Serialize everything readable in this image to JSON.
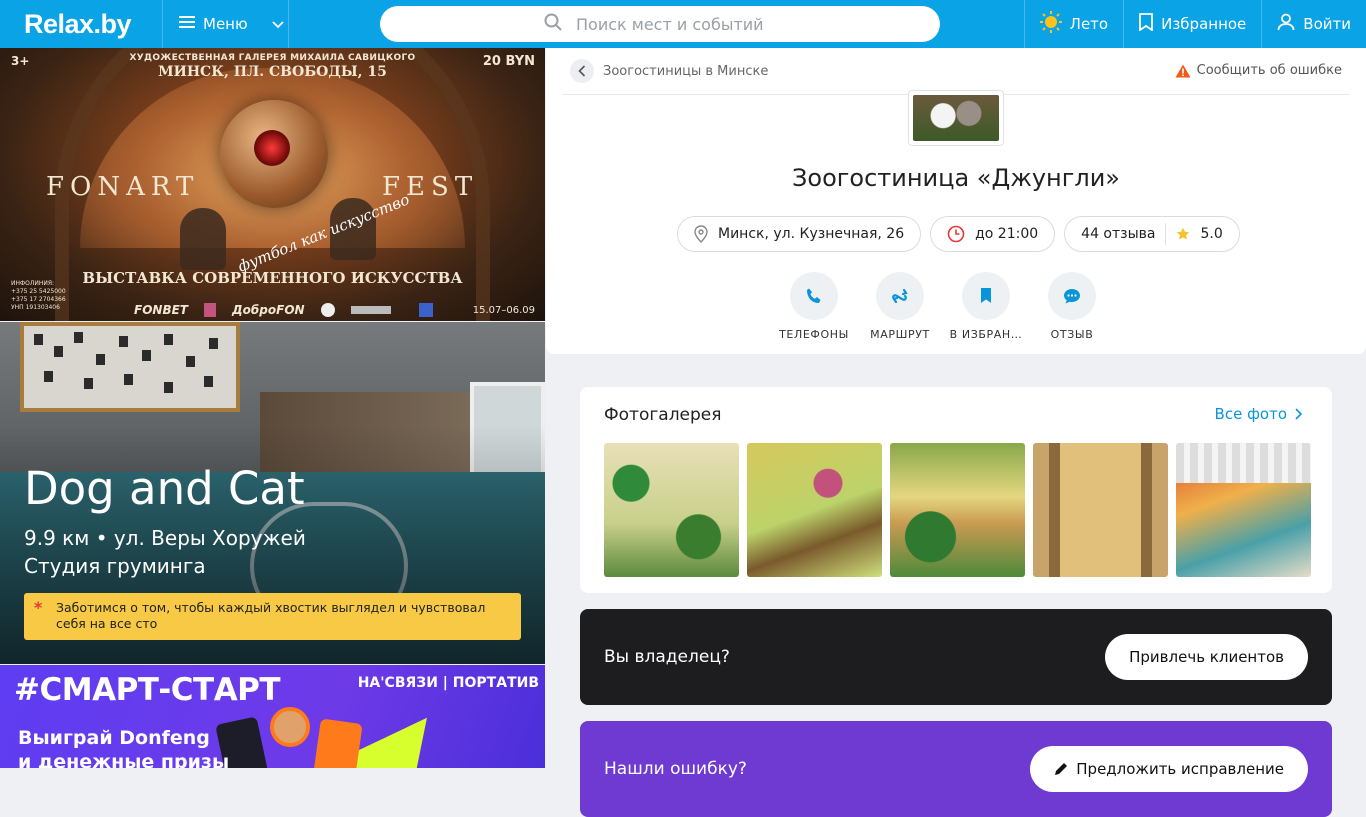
{
  "header": {
    "logo": "Relax.by",
    "menu_label": "Меню",
    "search_placeholder": "Поиск мест и событий",
    "season_label": "Лето",
    "favorites_label": "Избранное",
    "login_label": "Войти",
    "accent_color": "#0aa3e6"
  },
  "ads": {
    "banner1": {
      "age": "3+",
      "gallery": "ХУДОЖЕСТВЕННАЯ ГАЛЕРЕЯ МИХАИЛА САВИЦКОГО",
      "address": "МИНСК, ПЛ. СВОБОДЫ, 15",
      "price": "20 BYN",
      "title_left": "FONART",
      "title_right": "FEST",
      "slogan": "футбол как искусство",
      "subtitle": "ВЫСТАВКА СОВРЕМЕННОГО ИСКУССТВА",
      "info_line1": "ИНФОЛИНИЯ:",
      "info_line2": "+375 25 5425000",
      "info_line3": "+375 17 2704366",
      "info_line4": "УНП 191303406",
      "sponsor1": "FONBET",
      "sponsor2": "ДоброFON",
      "dates": "15.07–06.09"
    },
    "banner2": {
      "title": "Dog and Cat",
      "distance": "9.9 км • ул. Веры Хоружей",
      "type": "Студия груминга",
      "note": "Заботимся о том, чтобы каждый хвостик выглядел и чувствовал себя на все сто"
    },
    "banner3": {
      "title": "#СМАРТ-СТАРТ",
      "brands": "НА'СВЯЗИ | ПОРТАТИВ",
      "line1": "Выиграй Donfeng",
      "line2": "и денежные призы"
    }
  },
  "breadcrumb": {
    "label": "Зоогостиницы в Минске",
    "report": "Сообщить об ошибке"
  },
  "venue": {
    "title": "Зоогостиница «Джунгли»",
    "address": "Минск, ул. Кузнечная, 26",
    "hours": "до 21:00",
    "reviews": "44 отзыва",
    "rating": "5.0"
  },
  "actions": [
    {
      "label": "ТЕЛЕФОНЫ",
      "icon": "phone-icon"
    },
    {
      "label": "МАРШРУТ",
      "icon": "route-icon"
    },
    {
      "label": "В ИЗБРАН…",
      "icon": "bookmark-icon"
    },
    {
      "label": "ОТЗЫВ",
      "icon": "chat-icon"
    }
  ],
  "gallery": {
    "title": "Фотогалерея",
    "all_label": "Все фото"
  },
  "owner": {
    "question": "Вы владелец?",
    "button": "Привлечь клиентов"
  },
  "error": {
    "question": "Нашли ошибку?",
    "button": "Предложить исправление"
  }
}
